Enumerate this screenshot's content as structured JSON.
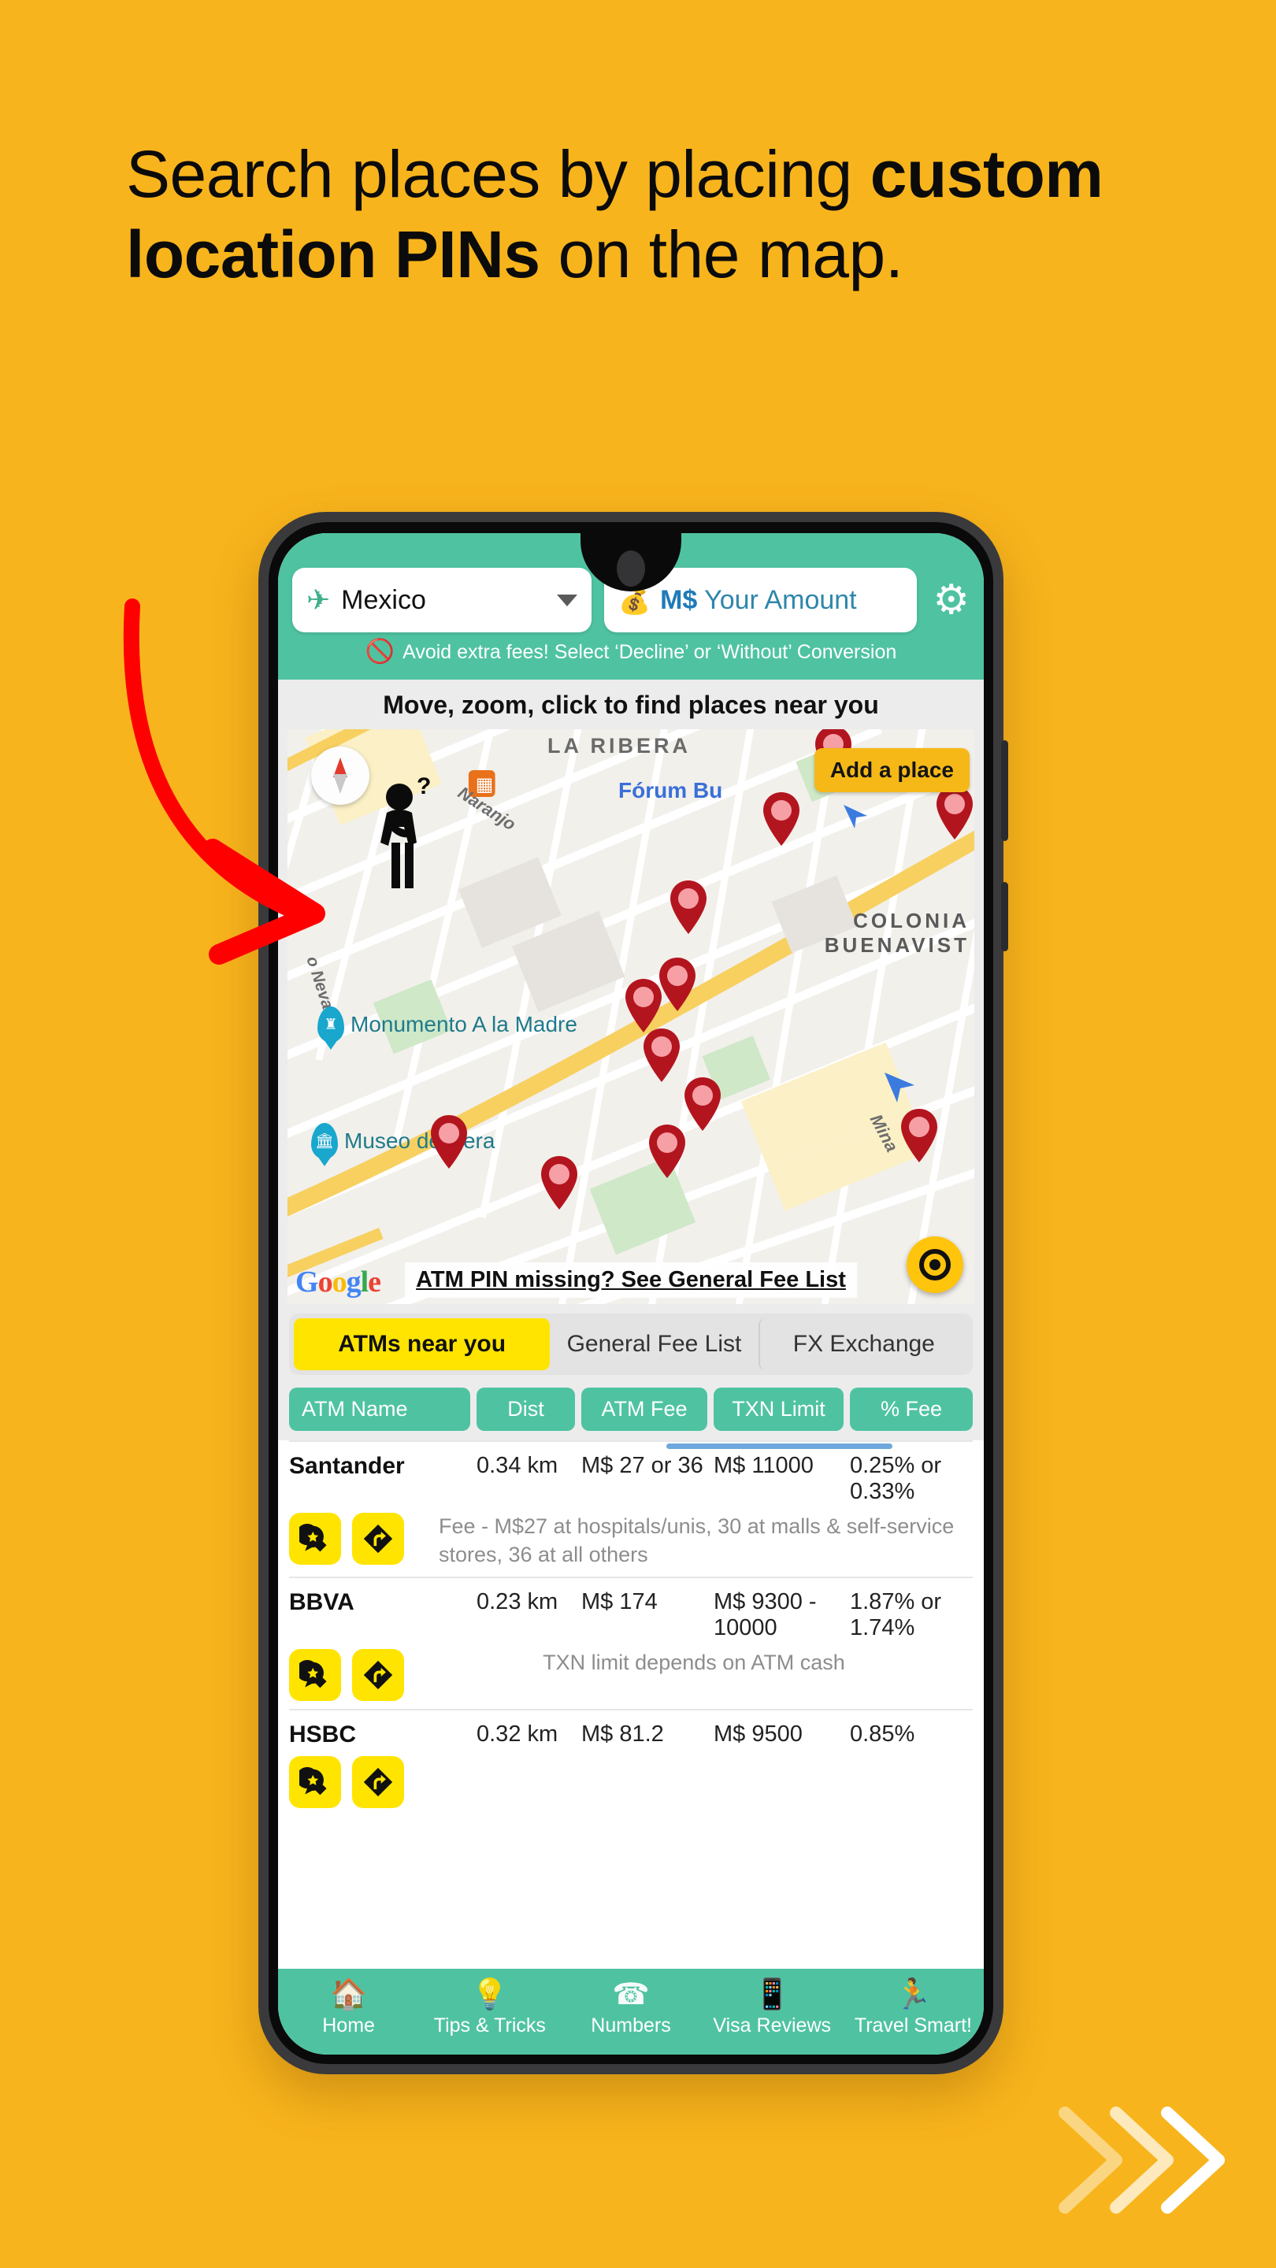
{
  "page": {
    "background_color": "#F8B41C",
    "headline_part1": "Search places by placing ",
    "headline_bold": "custom location PINs",
    "headline_part2": " on the map."
  },
  "app": {
    "topbar": {
      "country": "Mexico",
      "country_icon": "airplane-icon",
      "amount_currency": "M$",
      "amount_placeholder": "Your Amount",
      "amount_icon": "coins-icon",
      "settings_icon": "gear-icon",
      "warning_icon": "no-entry-icon",
      "warning_text": "Avoid extra fees! Select ‘Decline’ or ‘Without’ Conversion"
    },
    "map": {
      "title": "Move, zoom, click to find places near you",
      "add_place_label": "Add a place",
      "fee_link": "ATM PIN missing? See General Fee List",
      "attribution": "Google",
      "compass_icon": "compass-icon",
      "locate_icon": "locate-me-icon",
      "thinking_person_icon": "thinking-person-icon",
      "labels": {
        "la_ribera": "LA RIBERA",
        "colonia": "COLONIA",
        "buenavista": "BUENAVIST",
        "naranjo": "Naranjo",
        "mina": "Mina",
        "neva": "o Neva",
        "forum": "Fórum Bu"
      },
      "pois": [
        {
          "name": "Monumento A la Madre",
          "icon": "monument-pin-icon"
        },
        {
          "name": "Museo de Cera",
          "icon": "museum-pin-icon"
        }
      ]
    },
    "tabs": [
      {
        "label": "ATMs near you",
        "active": true
      },
      {
        "label": "General Fee List",
        "active": false
      },
      {
        "label": "FX Exchange",
        "active": false
      }
    ],
    "columns": [
      "ATM Name",
      "Dist",
      "ATM Fee",
      "TXN Limit",
      "% Fee"
    ],
    "rows": [
      {
        "name": "Santander",
        "dist": "0.34 km",
        "atm_fee": "M$ 27 or 36",
        "txn_limit": "M$ 11000",
        "pct_fee": "0.25% or 0.33%",
        "note": "Fee - M$27 at hospitals/unis, 30 at malls & self-service stores, 36 at all others",
        "note_align": "left",
        "actions": [
          "rate-place-icon",
          "directions-icon"
        ]
      },
      {
        "name": "BBVA",
        "dist": "0.23 km",
        "atm_fee": "M$ 174",
        "txn_limit": "M$ 9300 - 10000",
        "pct_fee": "1.87% or 1.74%",
        "note": "TXN limit depends on ATM cash",
        "note_align": "center",
        "actions": [
          "rate-place-icon",
          "directions-icon"
        ]
      },
      {
        "name": "HSBC",
        "dist": "0.32 km",
        "atm_fee": "M$ 81.2",
        "txn_limit": "M$ 9500",
        "pct_fee": "0.85%",
        "note": "",
        "note_align": "left",
        "actions": [
          "rate-place-icon",
          "directions-icon"
        ]
      }
    ],
    "bottom_nav": [
      {
        "label": "Home",
        "icon": "home-icon"
      },
      {
        "label": "Tips & Tricks",
        "icon": "lightbulb-icon"
      },
      {
        "label": "Numbers",
        "icon": "sos-icon"
      },
      {
        "label": "Visa Reviews",
        "icon": "passport-icon"
      },
      {
        "label": "Travel Smart!",
        "icon": "traveler-icon"
      }
    ]
  },
  "colors": {
    "brand_yellow": "#F8B41C",
    "teal": "#4FC3A1",
    "tab_yellow": "#FFE400",
    "pin_red": "#B3151F",
    "link_blue": "#2E86AB"
  },
  "decorations": {
    "red_arrow_icon": "curved-red-arrow",
    "chevrons_icon": "triple-chevron-right"
  }
}
